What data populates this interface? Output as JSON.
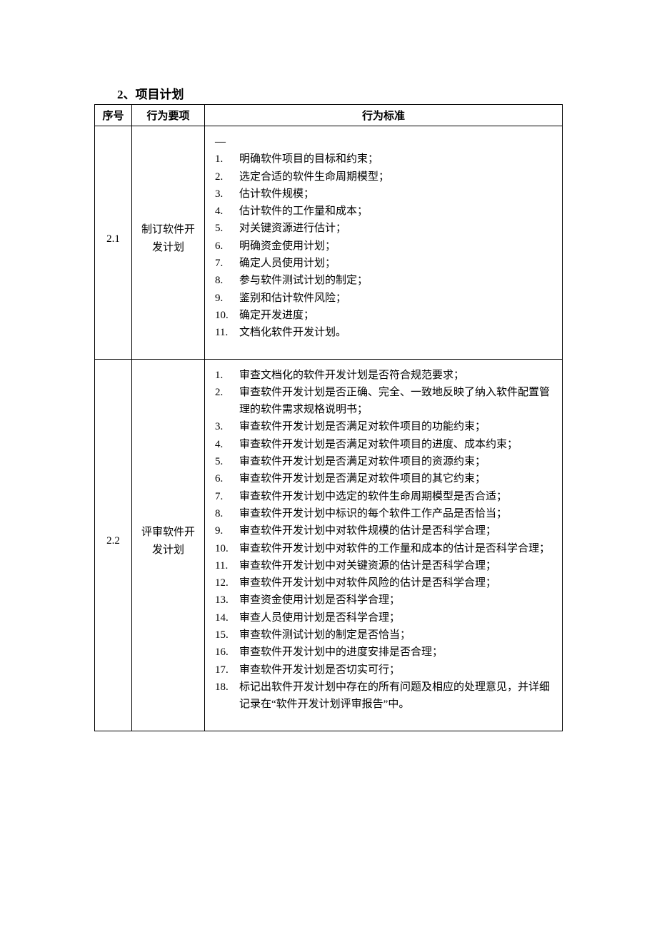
{
  "title": "2、项目计划",
  "headers": {
    "num": "序号",
    "item": "行为要项",
    "std": "行为标准"
  },
  "rows": [
    {
      "num": "2.1",
      "item": "制订软件开发计划",
      "topmark": "—",
      "standards": [
        "明确软件项目的目标和约束；",
        "选定合适的软件生命周期模型；",
        "估计软件规模；",
        "估计软件的工作量和成本；",
        "对关键资源进行估计；",
        "明确资金使用计划；",
        "确定人员使用计划；",
        "参与软件测试计划的制定；",
        "鉴别和估计软件风险；",
        "确定开发进度；",
        "文档化软件开发计划。"
      ]
    },
    {
      "num": "2.2",
      "item": "评审软件开发计划",
      "standards": [
        "审查文档化的软件开发计划是否符合规范要求；",
        "审查软件开发计划是否正确、完全、一致地反映了纳入软件配置管理的软件需求规格说明书；",
        "审查软件开发计划是否满足对软件项目的功能约束；",
        "审查软件开发计划是否满足对软件项目的进度、成本约束；",
        "审查软件开发计划是否满足对软件项目的资源约束；",
        "审查软件开发计划是否满足对软件项目的其它约束；",
        "审查软件开发计划中选定的软件生命周期模型是否合适；",
        "审查软件开发计划中标识的每个软件工作产品是否恰当；",
        "审查软件开发计划中对软件规模的估计是否科学合理；",
        "审查软件开发计划中对软件的工作量和成本的估计是否科学合理；",
        "审查软件开发计划中对关键资源的估计是否科学合理；",
        "审查软件开发计划中对软件风险的估计是否科学合理；",
        "审查资金使用计划是否科学合理；",
        "审查人员使用计划是否科学合理；",
        "审查软件测试计划的制定是否恰当；",
        "审查软件开发计划中的进度安排是否合理；",
        "审查软件开发计划是否切实可行；",
        "标记出软件开发计划中存在的所有问题及相应的处理意见，并详细记录在“软件开发计划评审报告”中。"
      ]
    }
  ]
}
